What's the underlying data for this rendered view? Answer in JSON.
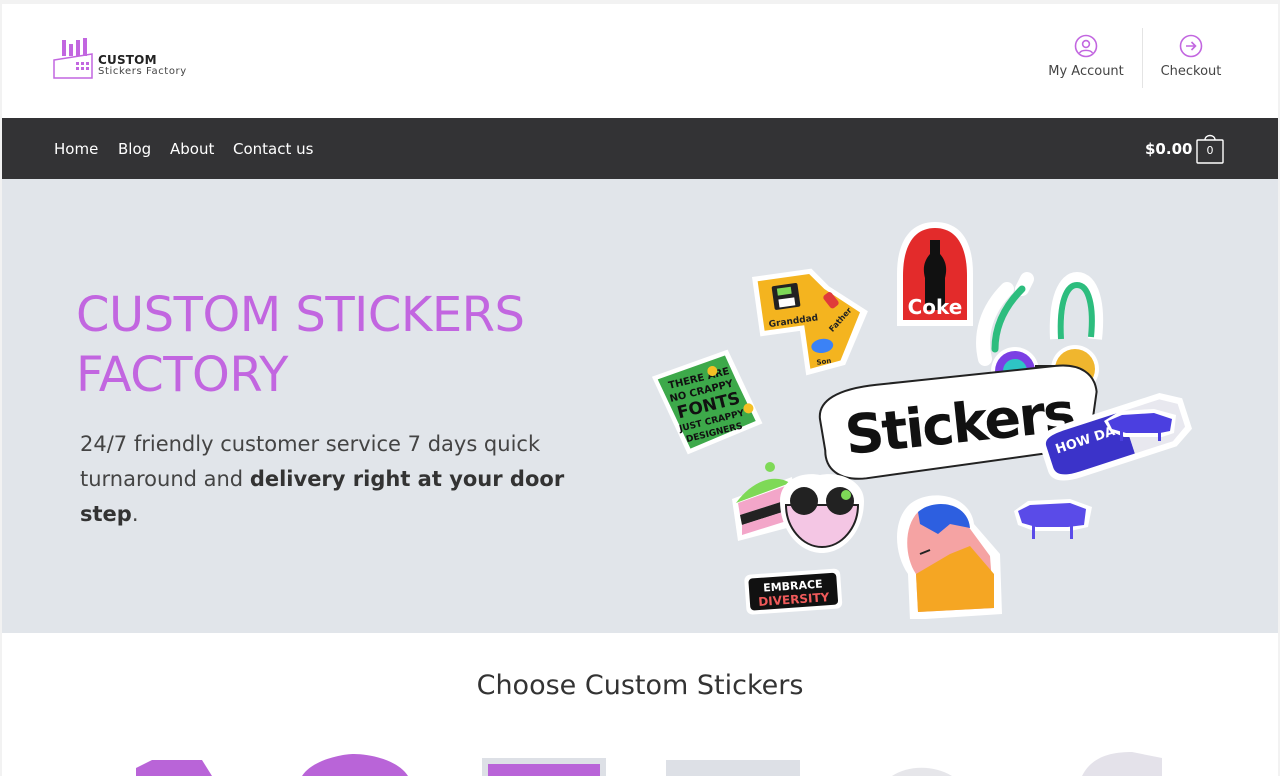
{
  "header": {
    "logo_line1": "CUSTOM",
    "logo_line2": "Stickers Factory",
    "account_label": "My Account",
    "checkout_label": "Checkout"
  },
  "nav": {
    "items": [
      {
        "label": "Home"
      },
      {
        "label": "Blog"
      },
      {
        "label": "About"
      },
      {
        "label": "Contact us"
      }
    ],
    "cart_total": "$0.00",
    "cart_count": "0"
  },
  "hero": {
    "title": "CUSTOM STICKERS FACTORY",
    "subtitle_plain": "24/7 friendly customer service 7 days quick turnaround and ",
    "subtitle_bold": "delivery right at your door step",
    "subtitle_end": ".",
    "stickers": {
      "main": "Stickers",
      "coke": "Coke",
      "granddad": "Granddad",
      "father": "Father",
      "son": "Son",
      "fonts_1": "THERE ARE",
      "fonts_2": "NO CRAPPY",
      "fonts_3": "FONTS",
      "fonts_4": "JUST CRAPPY",
      "fonts_5": "DESIGNERS",
      "how_dairy": "HOW DAIRY.",
      "embrace": "EMBRACE",
      "diversity": "DIVERSITY"
    }
  },
  "section": {
    "title": "Choose Custom Stickers"
  },
  "colors": {
    "accent": "#c266e0",
    "nav_bg": "#333335",
    "hero_bg": "#e1e5ea"
  }
}
